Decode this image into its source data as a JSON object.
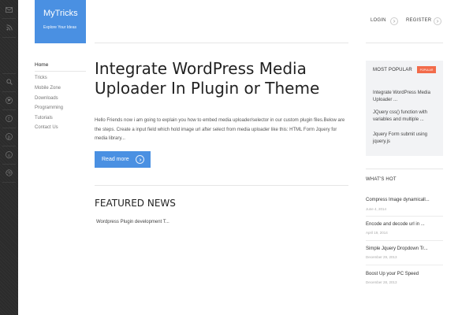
{
  "site": {
    "name": "MyTricks",
    "tagline": "Explore Your Ideas"
  },
  "header": {
    "login_label": "LOGIN",
    "register_label": "REGISTER"
  },
  "nav": {
    "items": [
      {
        "label": "Home"
      },
      {
        "label": "Tricks"
      },
      {
        "label": "Mobile Zone"
      },
      {
        "label": "Downloads"
      },
      {
        "label": "Programming"
      },
      {
        "label": "Tutorials"
      },
      {
        "label": "Contact Us"
      }
    ]
  },
  "post": {
    "title": "Integrate WordPress Media Uploader In Plugin or Theme",
    "excerpt": "Hello Friends now i am going to explain you how to embed media uploader/selector in our custom plugin files.Below are the steps. Create a input field which hold image url after select from media uploader like this: HTML Form Jquery for media library...",
    "read_more_label": "Read more"
  },
  "featured": {
    "title": "FEATURED NEWS",
    "items": [
      {
        "label": "Wordpress Plugin development T..."
      }
    ]
  },
  "popular": {
    "title": "MOST POPULAR",
    "badge": "POPULAR",
    "items": [
      {
        "label": "Integrate WordPress Media Uploader ..."
      },
      {
        "label": "JQuery css() function with variables and multiple ..."
      },
      {
        "label": "Jquery Form submit using jquery.js"
      }
    ]
  },
  "hot": {
    "title": "WHAT'S HOT",
    "items": [
      {
        "label": "Compress Image dynamicall...",
        "date": "June 4, 2014"
      },
      {
        "label": "Encode and decode url in ...",
        "date": "April 19, 2014"
      },
      {
        "label": "Simple Jquery Dropdown Tr...",
        "date": "December 29, 2013"
      },
      {
        "label": "Boost Up your PC Speed",
        "date": "December 28, 2013"
      }
    ]
  },
  "social": {
    "icons": [
      "mail-icon",
      "rss-icon",
      "search-icon",
      "twitter-icon",
      "facebook-icon",
      "pinterest-icon",
      "skype-icon",
      "dribbble-icon"
    ]
  },
  "colors": {
    "accent": "#4a90e2",
    "badge": "#f26b4a",
    "sidebar_dark": "#2b2b2b"
  }
}
